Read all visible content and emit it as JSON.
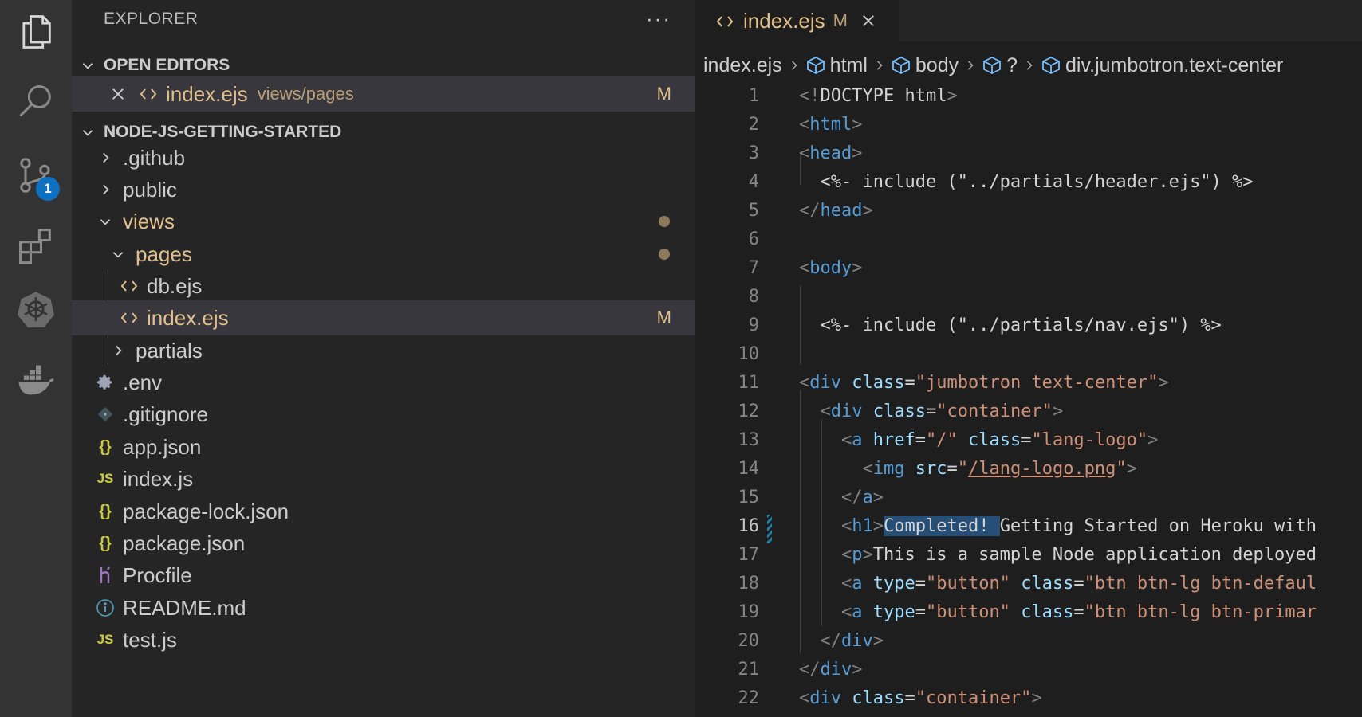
{
  "sidebar": {
    "header": "EXPLORER",
    "more": "···",
    "open_editors": {
      "title": "OPEN EDITORS",
      "items": [
        {
          "name": "index.ejs",
          "path": "views/pages",
          "status": "M"
        }
      ]
    },
    "project": {
      "title": "NODE-JS-GETTING-STARTED",
      "tree": [
        {
          "name": ".github",
          "type": "folder"
        },
        {
          "name": "public",
          "type": "folder"
        },
        {
          "name": "views",
          "type": "folder-open"
        },
        {
          "name": "pages",
          "type": "folder-open"
        },
        {
          "name": "db.ejs",
          "type": "ejs"
        },
        {
          "name": "index.ejs",
          "type": "ejs",
          "status": "M"
        },
        {
          "name": "partials",
          "type": "folder"
        },
        {
          "name": ".env",
          "type": "env"
        },
        {
          "name": ".gitignore",
          "type": "git"
        },
        {
          "name": "app.json",
          "type": "json"
        },
        {
          "name": "index.js",
          "type": "js"
        },
        {
          "name": "package-lock.json",
          "type": "json"
        },
        {
          "name": "package.json",
          "type": "json"
        },
        {
          "name": "Procfile",
          "type": "procfile"
        },
        {
          "name": "README.md",
          "type": "info"
        },
        {
          "name": "test.js",
          "type": "js"
        }
      ]
    }
  },
  "activity_bar": {
    "scm_badge": "1"
  },
  "editor": {
    "tab": {
      "name": "index.ejs",
      "status": "M"
    },
    "breadcrumb": [
      "index.ejs",
      "html",
      "body",
      "?",
      "div.jumbotron.text-center"
    ],
    "lines": [
      {
        "n": "1",
        "tokens": [
          [
            "br",
            "<!"
          ],
          [
            "txt",
            "DOCTYPE html"
          ],
          [
            "br",
            ">"
          ]
        ]
      },
      {
        "n": "2",
        "tokens": [
          [
            "br",
            "<"
          ],
          [
            "tag",
            "html"
          ],
          [
            "br",
            ">"
          ]
        ]
      },
      {
        "n": "3",
        "tokens": [
          [
            "br",
            "<"
          ],
          [
            "tag",
            "head"
          ],
          [
            "br",
            ">"
          ]
        ]
      },
      {
        "n": "4",
        "tokens": [
          [
            "txt",
            "  <%- include (\"../partials/header.ejs\") %>"
          ]
        ]
      },
      {
        "n": "5",
        "tokens": [
          [
            "br",
            "</"
          ],
          [
            "tag",
            "head"
          ],
          [
            "br",
            ">"
          ]
        ]
      },
      {
        "n": "6",
        "tokens": []
      },
      {
        "n": "7",
        "tokens": [
          [
            "br",
            "<"
          ],
          [
            "tag",
            "body"
          ],
          [
            "br",
            ">"
          ]
        ]
      },
      {
        "n": "8",
        "tokens": []
      },
      {
        "n": "9",
        "tokens": [
          [
            "txt",
            "  <%- include (\"../partials/nav.ejs\") %>"
          ]
        ]
      },
      {
        "n": "10",
        "tokens": []
      },
      {
        "n": "11",
        "tokens": [
          [
            "br",
            "<"
          ],
          [
            "tag",
            "div"
          ],
          [
            "txt",
            " "
          ],
          [
            "attr",
            "class"
          ],
          [
            "txt",
            "="
          ],
          [
            "str",
            "\"jumbotron text-center\""
          ],
          [
            "br",
            ">"
          ]
        ]
      },
      {
        "n": "12",
        "tokens": [
          [
            "txt",
            "  "
          ],
          [
            "br",
            "<"
          ],
          [
            "tag",
            "div"
          ],
          [
            "txt",
            " "
          ],
          [
            "attr",
            "class"
          ],
          [
            "txt",
            "="
          ],
          [
            "str",
            "\"container\""
          ],
          [
            "br",
            ">"
          ]
        ]
      },
      {
        "n": "13",
        "tokens": [
          [
            "txt",
            "    "
          ],
          [
            "br",
            "<"
          ],
          [
            "tag",
            "a"
          ],
          [
            "txt",
            " "
          ],
          [
            "attr",
            "href"
          ],
          [
            "txt",
            "="
          ],
          [
            "str",
            "\"/\""
          ],
          [
            "txt",
            " "
          ],
          [
            "attr",
            "class"
          ],
          [
            "txt",
            "="
          ],
          [
            "str",
            "\"lang-logo\""
          ],
          [
            "br",
            ">"
          ]
        ]
      },
      {
        "n": "14",
        "tokens": [
          [
            "txt",
            "      "
          ],
          [
            "br",
            "<"
          ],
          [
            "tag",
            "img"
          ],
          [
            "txt",
            " "
          ],
          [
            "attr",
            "src"
          ],
          [
            "txt",
            "="
          ],
          [
            "str",
            "\""
          ],
          [
            "link",
            "/lang-logo.png"
          ],
          [
            "str",
            "\""
          ],
          [
            "br",
            ">"
          ]
        ]
      },
      {
        "n": "15",
        "tokens": [
          [
            "txt",
            "    "
          ],
          [
            "br",
            "</"
          ],
          [
            "tag",
            "a"
          ],
          [
            "br",
            ">"
          ]
        ]
      },
      {
        "n": "16",
        "tokens": [
          [
            "txt",
            "    "
          ],
          [
            "br",
            "<"
          ],
          [
            "tag",
            "h1"
          ],
          [
            "br",
            ">"
          ],
          [
            "sel",
            "Completed! "
          ],
          [
            "txt",
            "Getting Started on Heroku with"
          ]
        ]
      },
      {
        "n": "17",
        "tokens": [
          [
            "txt",
            "    "
          ],
          [
            "br",
            "<"
          ],
          [
            "tag",
            "p"
          ],
          [
            "br",
            ">"
          ],
          [
            "txt",
            "This is a sample Node application deployed"
          ]
        ]
      },
      {
        "n": "18",
        "tokens": [
          [
            "txt",
            "    "
          ],
          [
            "br",
            "<"
          ],
          [
            "tag",
            "a"
          ],
          [
            "txt",
            " "
          ],
          [
            "attr",
            "type"
          ],
          [
            "txt",
            "="
          ],
          [
            "str",
            "\"button\""
          ],
          [
            "txt",
            " "
          ],
          [
            "attr",
            "class"
          ],
          [
            "txt",
            "="
          ],
          [
            "str",
            "\"btn btn-lg btn-defaul"
          ]
        ]
      },
      {
        "n": "19",
        "tokens": [
          [
            "txt",
            "    "
          ],
          [
            "br",
            "<"
          ],
          [
            "tag",
            "a"
          ],
          [
            "txt",
            " "
          ],
          [
            "attr",
            "type"
          ],
          [
            "txt",
            "="
          ],
          [
            "str",
            "\"button\""
          ],
          [
            "txt",
            " "
          ],
          [
            "attr",
            "class"
          ],
          [
            "txt",
            "="
          ],
          [
            "str",
            "\"btn btn-lg btn-primar"
          ]
        ]
      },
      {
        "n": "20",
        "tokens": [
          [
            "txt",
            "  "
          ],
          [
            "br",
            "</"
          ],
          [
            "tag",
            "div"
          ],
          [
            "br",
            ">"
          ]
        ]
      },
      {
        "n": "21",
        "tokens": [
          [
            "br",
            "</"
          ],
          [
            "tag",
            "div"
          ],
          [
            "br",
            ">"
          ]
        ]
      },
      {
        "n": "22",
        "tokens": [
          [
            "br",
            "<"
          ],
          [
            "tag",
            "div"
          ],
          [
            "txt",
            " "
          ],
          [
            "attr",
            "class"
          ],
          [
            "txt",
            "="
          ],
          [
            "str",
            "\"container\""
          ],
          [
            "br",
            ">"
          ]
        ]
      }
    ],
    "active_line": "16"
  },
  "colors": {
    "modified": "#e2c08d",
    "tag": "#569cd6",
    "attr": "#9cdcfe",
    "string": "#ce9178",
    "badge": "#0e70c0",
    "selection": "#264f78"
  }
}
